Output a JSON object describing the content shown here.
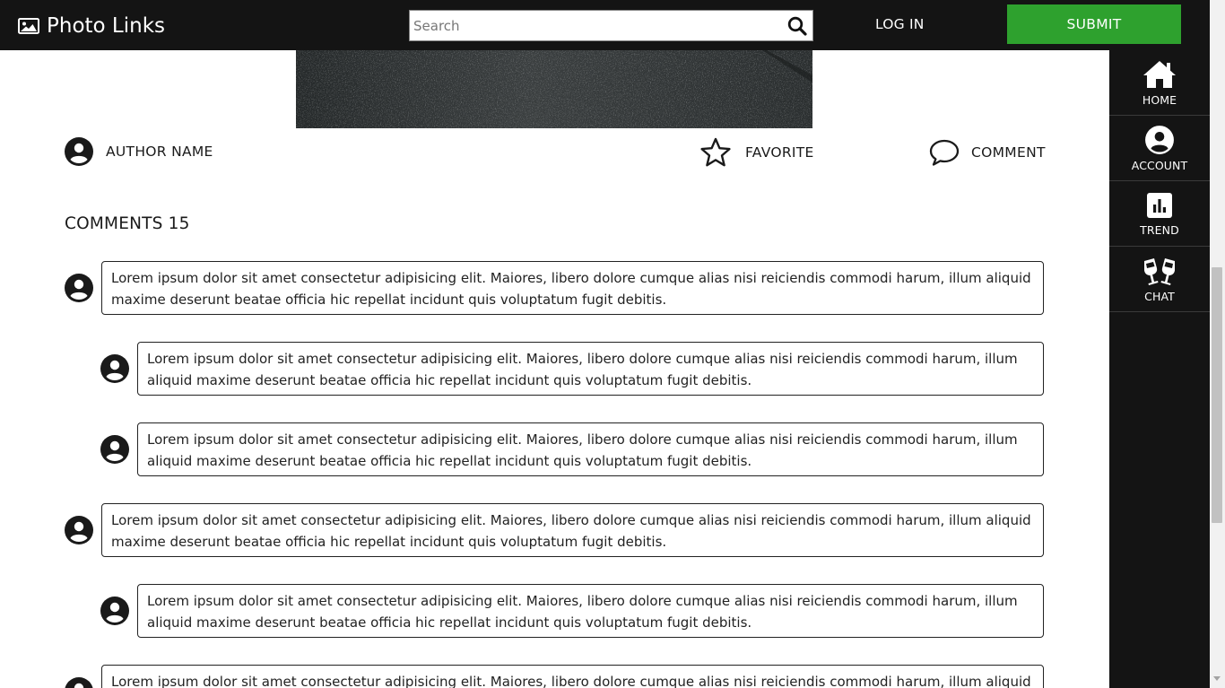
{
  "header": {
    "brand": "Photo Links",
    "brand_icon": "image-icon",
    "search_placeholder": "Search",
    "search_icon": "search-icon",
    "login_label": "LOG IN",
    "submit_label": "SUBMIT",
    "submit_color": "#2ea12e",
    "bar_color": "#141414"
  },
  "sidebar": {
    "items": [
      {
        "label": "HOME",
        "icon": "home-icon"
      },
      {
        "label": "ACCOUNT",
        "icon": "account-icon"
      },
      {
        "label": "TREND",
        "icon": "chart-icon"
      },
      {
        "label": "CHAT",
        "icon": "cheers-icon"
      }
    ]
  },
  "post": {
    "author_label": "AUTHOR NAME",
    "favorite_label": "FAVORITE",
    "comment_label": "COMMENT"
  },
  "comments": {
    "title": "COMMENTS 15",
    "items": [
      {
        "text": "Lorem ipsum dolor sit amet consectetur adipisicing elit. Maiores, libero dolore cumque alias nisi reiciendis commodi harum, illum aliquid maxime deserunt beatae officia hic repellat incidunt quis voluptatum fugit debitis.",
        "reply": false
      },
      {
        "text": "Lorem ipsum dolor sit amet consectetur adipisicing elit. Maiores, libero dolore cumque alias nisi reiciendis commodi harum, illum aliquid maxime deserunt beatae officia hic repellat incidunt quis voluptatum fugit debitis.",
        "reply": true
      },
      {
        "text": "Lorem ipsum dolor sit amet consectetur adipisicing elit. Maiores, libero dolore cumque alias nisi reiciendis commodi harum, illum aliquid maxime deserunt beatae officia hic repellat incidunt quis voluptatum fugit debitis.",
        "reply": true
      },
      {
        "text": "Lorem ipsum dolor sit amet consectetur adipisicing elit. Maiores, libero dolore cumque alias nisi reiciendis commodi harum, illum aliquid maxime deserunt beatae officia hic repellat incidunt quis voluptatum fugit debitis.",
        "reply": false
      },
      {
        "text": "Lorem ipsum dolor sit amet consectetur adipisicing elit. Maiores, libero dolore cumque alias nisi reiciendis commodi harum, illum aliquid maxime deserunt beatae officia hic repellat incidunt quis voluptatum fugit debitis.",
        "reply": true
      },
      {
        "text": "Lorem ipsum dolor sit amet consectetur adipisicing elit. Maiores, libero dolore cumque alias nisi reiciendis commodi harum, illum aliquid maxime deserunt beatae officia hic repellat incidunt quis voluptatum fugit debitis.",
        "reply": false
      }
    ]
  }
}
